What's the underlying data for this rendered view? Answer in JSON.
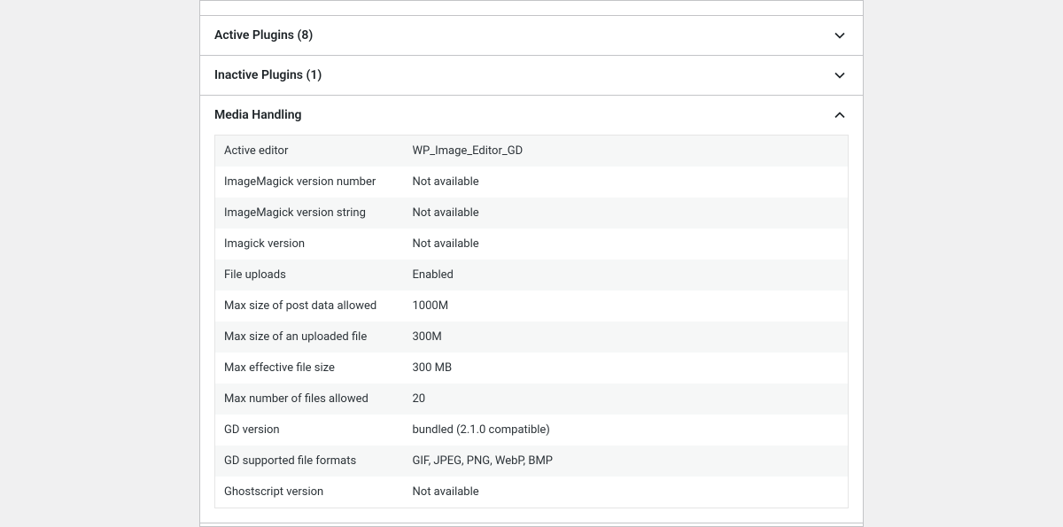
{
  "panels": {
    "active_plugins": {
      "title": "Active Plugins (8)"
    },
    "inactive_plugins": {
      "title": "Inactive Plugins (1)"
    },
    "media_handling": {
      "title": "Media Handling"
    }
  },
  "media_rows": [
    {
      "label": "Active editor",
      "value": "WP_Image_Editor_GD"
    },
    {
      "label": "ImageMagick version number",
      "value": "Not available"
    },
    {
      "label": "ImageMagick version string",
      "value": "Not available"
    },
    {
      "label": "Imagick version",
      "value": "Not available"
    },
    {
      "label": "File uploads",
      "value": "Enabled"
    },
    {
      "label": "Max size of post data allowed",
      "value": "1000M"
    },
    {
      "label": "Max size of an uploaded file",
      "value": "300M"
    },
    {
      "label": "Max effective file size",
      "value": "300 MB"
    },
    {
      "label": "Max number of files allowed",
      "value": "20"
    },
    {
      "label": "GD version",
      "value": "bundled (2.1.0 compatible)"
    },
    {
      "label": "GD supported file formats",
      "value": "GIF, JPEG, PNG, WebP, BMP"
    },
    {
      "label": "Ghostscript version",
      "value": "Not available"
    }
  ]
}
